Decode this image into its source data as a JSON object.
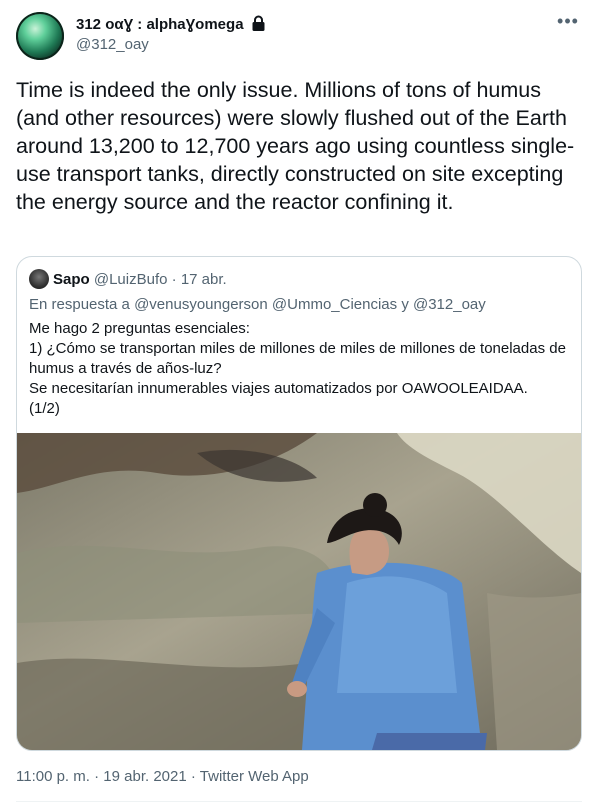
{
  "author": {
    "display_name": "312 οαƔ : alphaƔomega",
    "handle": "@312_oay"
  },
  "more_icon": "more-horizontal-icon",
  "tweet": {
    "text": "Time is indeed the only issue. Millions of tons of humus (and other resources) were slowly flushed out of the Earth around 13,200 to 12,700 years ago using countless single-use transport tanks, directly constructed on site excepting the energy source and the reactor confining it."
  },
  "quoted_tweet": {
    "display_name": "Sapo",
    "handle": "@LuizBufo",
    "separator": "·",
    "date": "17 abr.",
    "reply_prefix": "En respuesta a",
    "reply_mentions": "@venusyoungerson @Ummo_Ciencias y @312_oay",
    "text_lines": [
      "Me hago 2 preguntas esenciales:",
      "1) ¿Cómo se transportan miles de millones de miles de millones de toneladas de humus a través de años-luz?",
      "Se necesitarían innumerables viajes automatizados por OAWOOLEAIDAA.",
      "(1/2)"
    ]
  },
  "footer": {
    "time": "11:00 p. m.",
    "separator": "·",
    "date": "19 abr. 2021",
    "source": "Twitter Web App"
  }
}
